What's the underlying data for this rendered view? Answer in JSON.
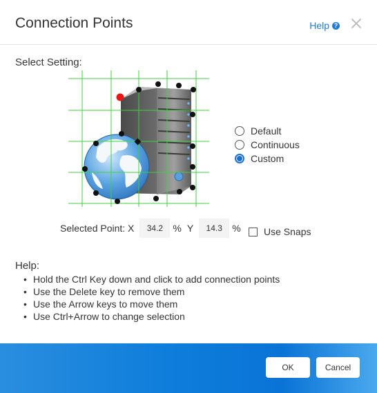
{
  "dialog": {
    "title": "Connection Points",
    "help_label": "Help",
    "help_icon_glyph": "?"
  },
  "setting": {
    "label": "Select Setting:",
    "options": [
      {
        "label": "Default",
        "checked": false
      },
      {
        "label": "Continuous",
        "checked": false
      },
      {
        "label": "Custom",
        "checked": true
      }
    ]
  },
  "point": {
    "label": "Selected Point: X",
    "x_value": "34.2",
    "pct1": "%",
    "y_label": "Y",
    "y_value": "14.3",
    "pct2": "%",
    "snaps_label": "Use Snaps"
  },
  "help": {
    "title": "Help:",
    "items": [
      "Hold the Ctrl Key down and click to add connection points",
      "Use the Delete key to remove them",
      "Use the Arrow keys to move them",
      "Use Ctrl+Arrow to change selection"
    ]
  },
  "buttons": {
    "ok": "OK",
    "cancel": "Cancel"
  },
  "colors": {
    "accent": "#1f7ad6",
    "grid": "#3cd23c",
    "selected_point": "#e81818",
    "point": "#111111"
  },
  "icons": {
    "close": "close-icon",
    "help": "help-circle-icon",
    "image": "server-globe-icon"
  }
}
